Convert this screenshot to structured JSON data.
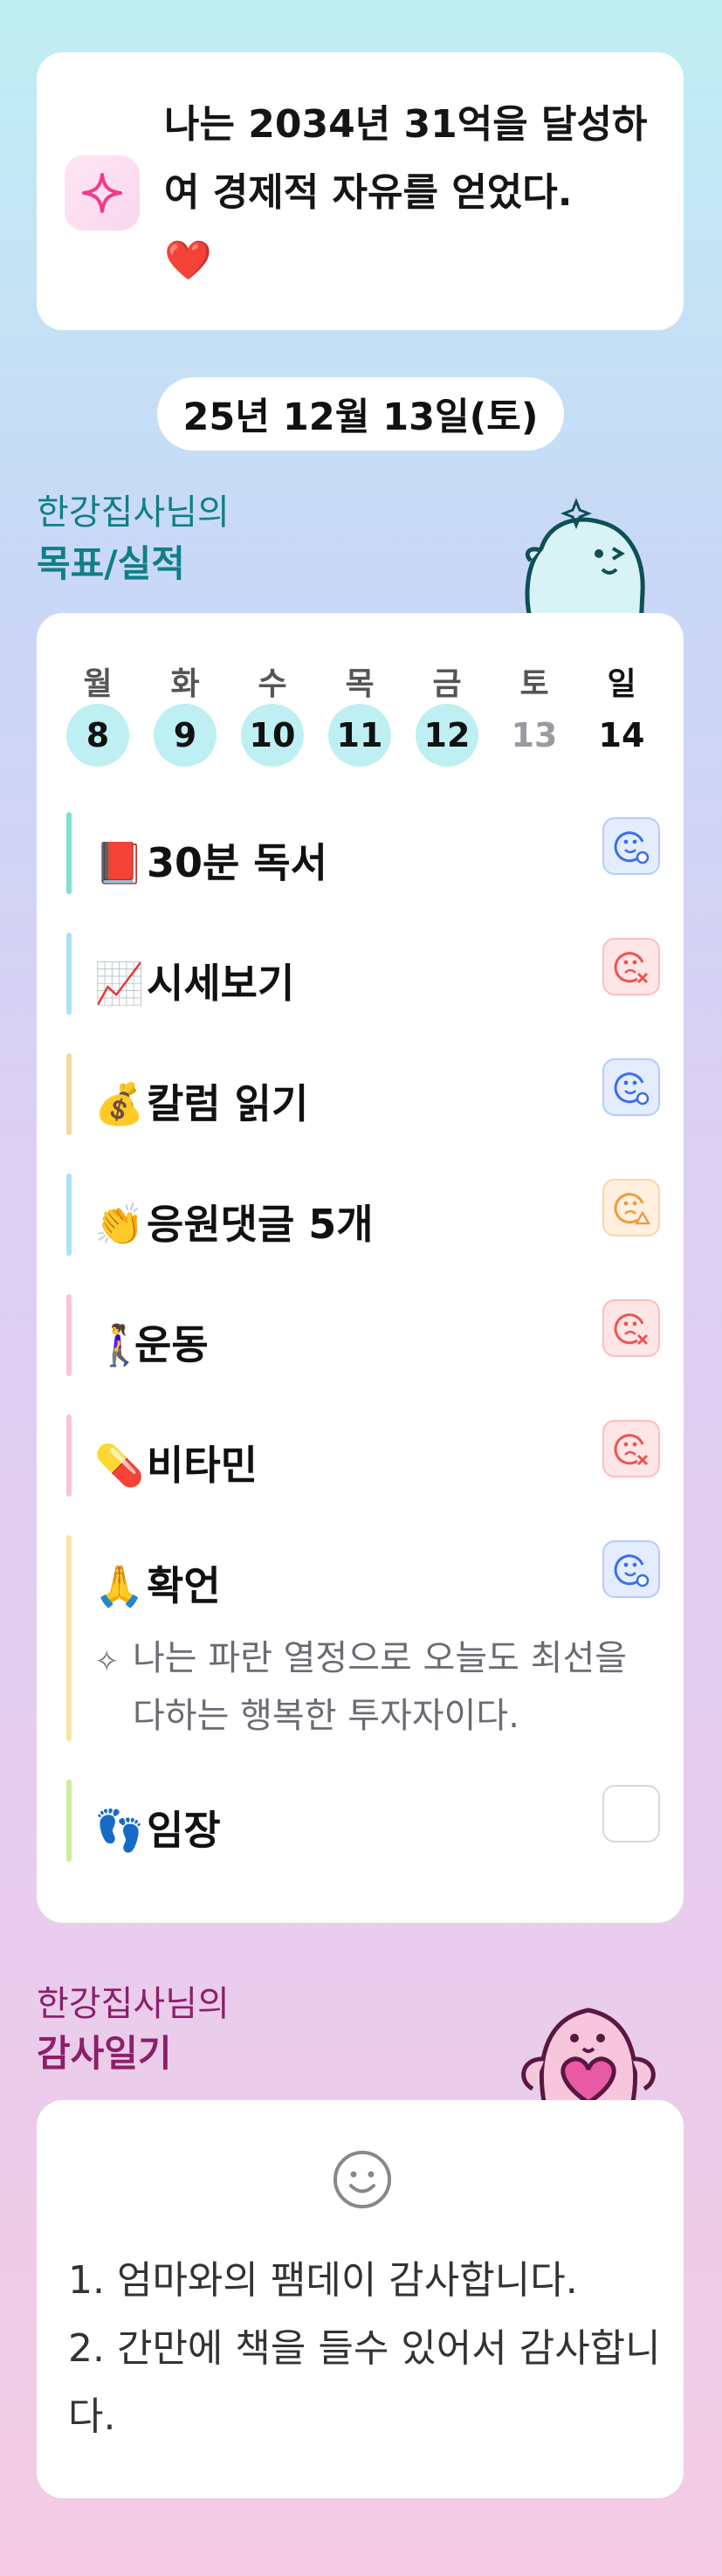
{
  "goal": {
    "text": "나는 2034년 31억을 달성하여 경제적 자유를 얻었다.",
    "heart": "❤️"
  },
  "date": "25년 12월 13일(토)",
  "goals_section": {
    "subtitle": "한강집사님의",
    "title": "목표/실적"
  },
  "week": {
    "days": [
      {
        "name": "월",
        "num": "8",
        "state": "done"
      },
      {
        "name": "화",
        "num": "9",
        "state": "done"
      },
      {
        "name": "수",
        "num": "10",
        "state": "done"
      },
      {
        "name": "목",
        "num": "11",
        "state": "done"
      },
      {
        "name": "금",
        "num": "12",
        "state": "done"
      },
      {
        "name": "토",
        "num": "13",
        "state": "future"
      },
      {
        "name": "일",
        "num": "14",
        "state": "today"
      }
    ]
  },
  "habits": [
    {
      "emoji": "📕",
      "label": "30분 독서",
      "status": "good",
      "bar_color": "#7fe0cf"
    },
    {
      "emoji": "📈",
      "label": "시세보기",
      "status": "bad",
      "bar_color": "#a9e3f5"
    },
    {
      "emoji": "💰",
      "label": "칼럼 읽기",
      "status": "good",
      "bar_color": "#f8d9a2"
    },
    {
      "emoji": "👏",
      "label": "응원댓글 5개",
      "status": "meh",
      "bar_color": "#a9e3f5"
    },
    {
      "emoji": "🚶‍♀️",
      "label": "운동",
      "status": "bad",
      "bar_color": "#f7c3dd"
    },
    {
      "emoji": "💊",
      "label": "비타민",
      "status": "bad",
      "bar_color": "#f7c3dd"
    },
    {
      "emoji": "🙏",
      "label": "확언",
      "status": "good",
      "bar_color": "#f8e4a8"
    },
    {
      "emoji": "👣",
      "label": "임장",
      "status": "empty",
      "bar_color": "#c9ef9d"
    }
  ],
  "affirmation": {
    "icon": "sparkle-icon",
    "text": "나는 파란 열정으로 오늘도 최선을 다하는 행복한 투자자이다."
  },
  "gratitude_section": {
    "subtitle": "한강집사님의",
    "title": "감사일기"
  },
  "gratitude": {
    "icon": "smile-face-icon",
    "text": "1. 엄마와의 팸데이 감사합니다.\n2. 간만에 책을 들수 있어서 감사합니다."
  },
  "colors": {
    "accent_teal": "#0f7f86",
    "accent_magenta": "#8c1f6a",
    "day_done": "#bdeff3",
    "status_good": "#3a6df0",
    "status_bad": "#f05252",
    "status_meh": "#f29a3b"
  }
}
